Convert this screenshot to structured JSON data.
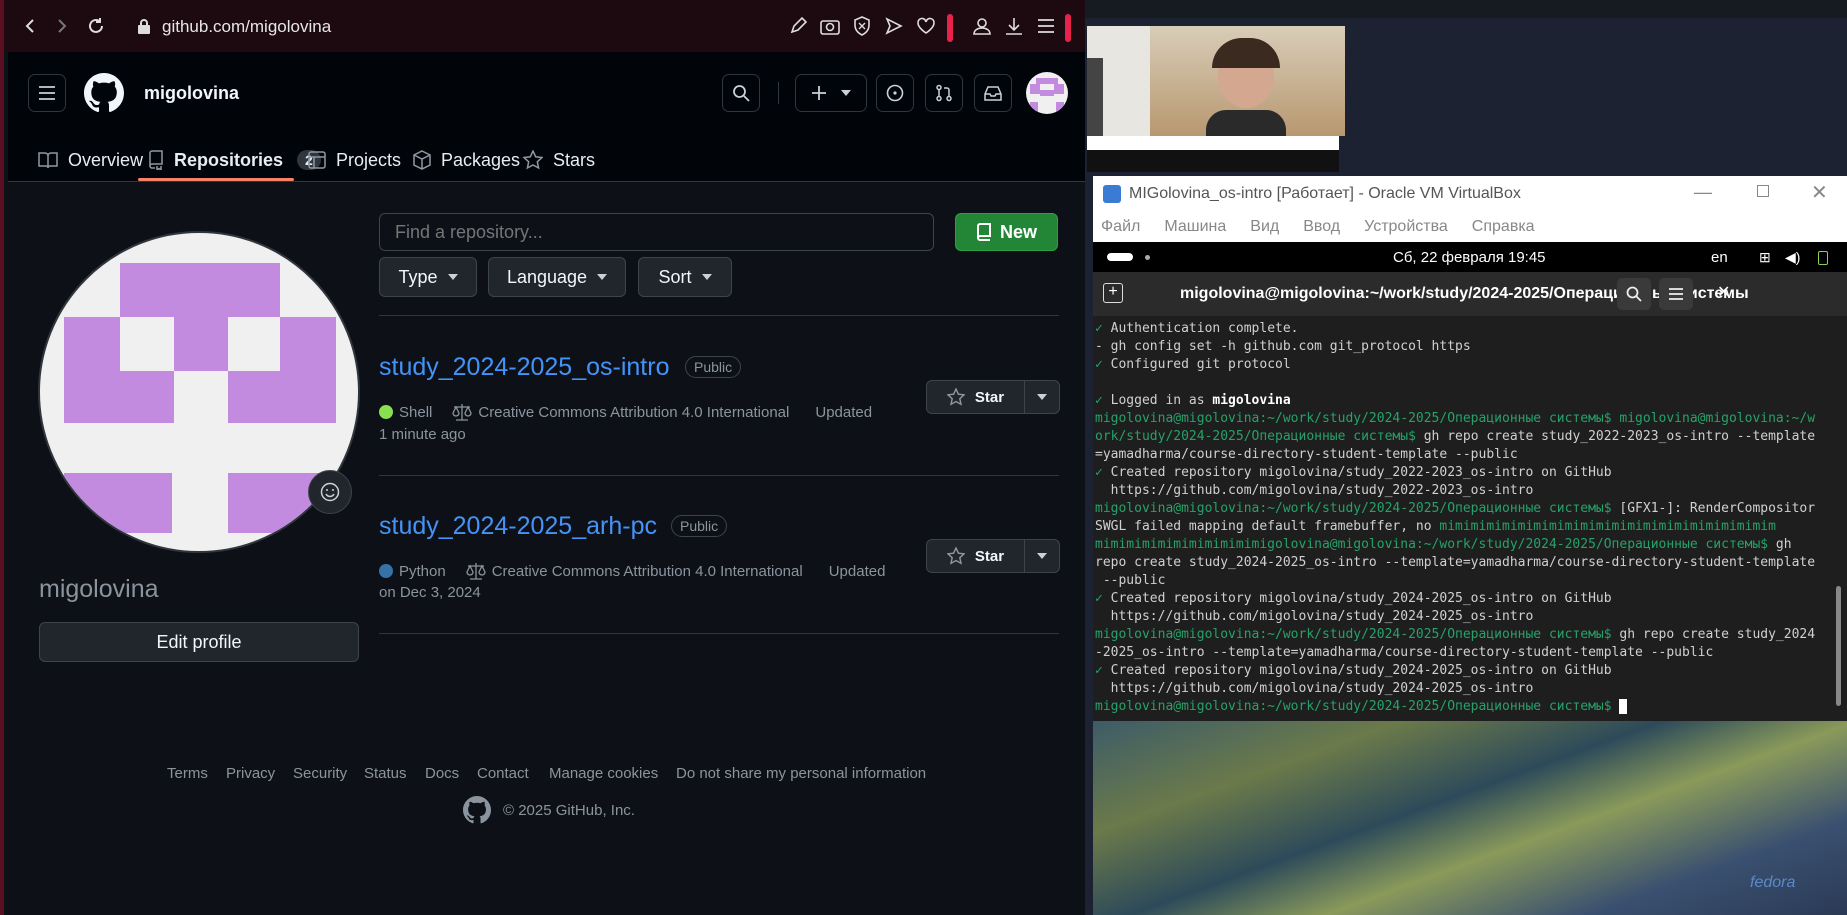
{
  "browser": {
    "url": "github.com/migolovina"
  },
  "gh": {
    "username": "migolovina",
    "tabs": [
      {
        "label": "Overview"
      },
      {
        "label": "Repositories",
        "count": "2"
      },
      {
        "label": "Projects"
      },
      {
        "label": "Packages"
      },
      {
        "label": "Stars"
      }
    ],
    "profile_name": "migolovina",
    "edit_profile": "Edit profile",
    "search_placeholder": "Find a repository...",
    "new_label": "New",
    "filters": {
      "type": "Type",
      "language": "Language",
      "sort": "Sort"
    },
    "repos": [
      {
        "name": "study_2024-2025_os-intro",
        "visibility": "Public",
        "language": "Shell",
        "lang_color": "#89e051",
        "license": "Creative Commons Attribution 4.0 International",
        "updated": "Updated",
        "updated_when": "1 minute ago",
        "star": "Star"
      },
      {
        "name": "study_2024-2025_arh-pc",
        "visibility": "Public",
        "language": "Python",
        "lang_color": "#3572A5",
        "license": "Creative Commons Attribution 4.0 International",
        "updated": "Updated",
        "updated_when": "on Dec 3, 2024",
        "star": "Star"
      }
    ],
    "footer": {
      "links": [
        "Terms",
        "Privacy",
        "Security",
        "Status",
        "Docs",
        "Contact",
        "Manage cookies",
        "Do not share my personal information"
      ],
      "copyright": "© 2025 GitHub, Inc."
    }
  },
  "vbox": {
    "title": "MIGolovina_os-intro [Работает] - Oracle VM VirtualBox",
    "menu": [
      "Файл",
      "Машина",
      "Вид",
      "Ввод",
      "Устройства",
      "Справка"
    ],
    "gnome": {
      "date": "Сб, 22 февраля  19:45",
      "lang": "en"
    },
    "term_title": "migolovina@migolovina:~/work/study/2024-2025/Операционные системы",
    "lines": [
      {
        "a": "✓ ",
        "b": "Authentication complete."
      },
      {
        "a": "- ",
        "b": "gh config set -h github.com git_protocol https"
      },
      {
        "a": "✓ ",
        "b": "Configured git protocol"
      },
      {
        "a": "",
        "b": ""
      },
      {
        "a": "✓ ",
        "b": "Logged in as ",
        "c": "migolovina"
      },
      {
        "a": "migolovina@migolovina:~/work/study/2024-2025/Операционные системы$ ",
        "b": "migolovina@migolovina:~/w",
        "g2": true
      },
      {
        "a": "ork/study/2024-2025/Операционные системы$ ",
        "b": "gh repo create study_2022-2023_os-intro --template"
      },
      {
        "a": "",
        "b": "=yamadharma/course-directory-student-template --public"
      },
      {
        "a": "✓ ",
        "b": "Created repository migolovina/study_2022-2023_os-intro on GitHub"
      },
      {
        "a": "",
        "b": "  https://github.com/migolovina/study_2022-2023_os-intro"
      },
      {
        "a": "migolovina@migolovina:~/work/study/2024-2025/Операционные системы$ ",
        "b": "[GFX1-]: RenderCompositor"
      },
      {
        "a": "",
        "b": "SWGL failed mapping default framebuffer, no ",
        "c2": "mimimimimimimimimimimimimimimimimimimimimim"
      },
      {
        "a": "mimimimimimimimimimimigolovina@migolovina:~/work/study/2024-2025/Операционные системы$ ",
        "b": "gh"
      },
      {
        "a": "",
        "b": "repo create study_2024-2025_os-intro --template=yamadharma/course-directory-student-template"
      },
      {
        "a": "",
        "b": " --public"
      },
      {
        "a": "✓ ",
        "b": "Created repository migolovina/study_2024-2025_os-intro on GitHub"
      },
      {
        "a": "",
        "b": "  https://github.com/migolovina/study_2024-2025_os-intro"
      },
      {
        "a": "migolovina@migolovina:~/work/study/2024-2025/Операционные системы$ ",
        "b": "gh repo create study_2024"
      },
      {
        "a": "",
        "b": "-2025_os-intro --template=yamadharma/course-directory-student-template --public"
      },
      {
        "a": "✓ ",
        "b": "Created repository migolovina/study_2024-2025_os-intro on GitHub"
      },
      {
        "a": "",
        "b": "  https://github.com/migolovina/study_2024-2025_os-intro"
      },
      {
        "a": "migolovina@migolovina:~/work/study/2024-2025/Операционные системы$ ",
        "b": "",
        "cursor": true
      }
    ],
    "fedora": "fedora"
  }
}
